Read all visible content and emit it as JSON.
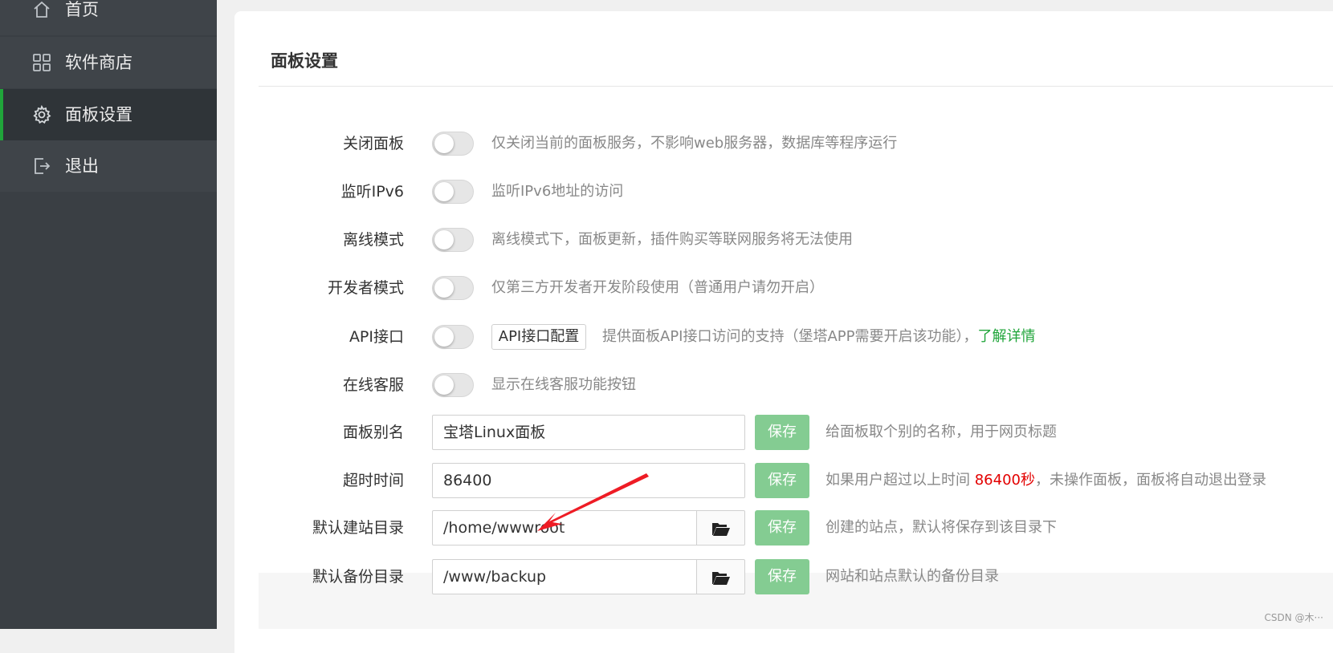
{
  "sidebar": {
    "items": [
      {
        "label": "首页",
        "icon": "home-icon"
      },
      {
        "label": "软件商店",
        "icon": "grid-icon"
      },
      {
        "label": "面板设置",
        "icon": "gear-icon",
        "active": true
      },
      {
        "label": "退出",
        "icon": "logout-icon"
      }
    ]
  },
  "panel": {
    "title": "面板设置",
    "rows": {
      "close_panel": {
        "label": "关闭面板",
        "desc": "仅关闭当前的面板服务，不影响web服务器，数据库等程序运行",
        "enabled": false
      },
      "ipv6": {
        "label": "监听IPv6",
        "desc": "监听IPv6地址的访问",
        "enabled": false
      },
      "offline": {
        "label": "离线模式",
        "desc": "离线模式下，面板更新，插件购买等联网服务将无法使用",
        "enabled": false
      },
      "developer": {
        "label": "开发者模式",
        "desc": "仅第三方开发者开发阶段使用（普通用户请勿开启）",
        "enabled": false
      },
      "api": {
        "label": "API接口",
        "button": "API接口配置",
        "desc": "提供面板API接口访问的支持（堡塔APP需要开启该功能），",
        "link": "了解详情",
        "enabled": false
      },
      "online_service": {
        "label": "在线客服",
        "desc": "显示在线客服功能按钮",
        "enabled": false
      },
      "alias": {
        "label": "面板别名",
        "value": "宝塔Linux面板",
        "save": "保存",
        "desc": "给面板取个别的名称，用于网页标题"
      },
      "timeout": {
        "label": "超时时间",
        "value": "86400",
        "save": "保存",
        "desc_pre": "如果用户超过以上时间 ",
        "desc_highlight": "86400秒",
        "desc_post": "，未操作面板，面板将自动退出登录"
      },
      "site_dir": {
        "label": "默认建站目录",
        "value": "/home/wwwroot",
        "save": "保存",
        "desc": "创建的站点，默认将保存到该目录下"
      },
      "backup_dir": {
        "label": "默认备份目录",
        "value": "/www/backup",
        "save": "保存",
        "desc": "网站和站点默认的备份目录"
      }
    }
  },
  "colors": {
    "accent": "#20a53a",
    "save_button": "#84cc92",
    "highlight_red": "#e30000",
    "sidebar_bg": "#3a3f44"
  },
  "watermark": "CSDN @木···"
}
